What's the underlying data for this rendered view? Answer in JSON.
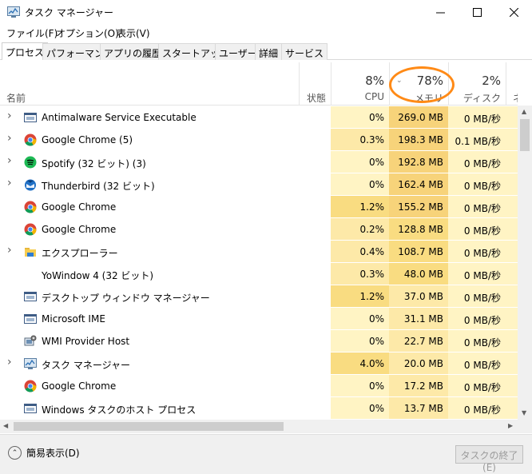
{
  "window": {
    "title": "タスク マネージャー",
    "controls": {
      "minimize": "—",
      "maximize": "☐",
      "close": "✕"
    }
  },
  "menu": [
    "ファイル(F)",
    "オプション(O)",
    "表示(V)"
  ],
  "tabs": [
    "プロセス",
    "パフォーマンス",
    "アプリの履歴",
    "スタートアップ",
    "ユーザー",
    "詳細",
    "サービス"
  ],
  "active_tab": "プロセス",
  "header": {
    "name": "名前",
    "status": "状態",
    "cpu": {
      "pct": "8%",
      "label": "CPU"
    },
    "memory": {
      "pct": "78%",
      "label": "メモリ"
    },
    "disk": {
      "pct": "2%",
      "label": "ディスク"
    },
    "network": {
      "label": "ネッ"
    }
  },
  "processes": [
    {
      "name": "Antimalware Service Executable",
      "icon": "service-window-icon",
      "expandable": true,
      "cpu": "0%",
      "memory": "269.0 MB",
      "disk": "0 MB/秒"
    },
    {
      "name": "Google Chrome (5)",
      "icon": "chrome-icon",
      "expandable": true,
      "cpu": "0.3%",
      "memory": "198.3 MB",
      "disk": "0.1 MB/秒"
    },
    {
      "name": "Spotify (32 ビット) (3)",
      "icon": "spotify-icon",
      "expandable": true,
      "cpu": "0%",
      "memory": "192.8 MB",
      "disk": "0 MB/秒"
    },
    {
      "name": "Thunderbird (32 ビット)",
      "icon": "thunderbird-icon",
      "expandable": true,
      "cpu": "0%",
      "memory": "162.4 MB",
      "disk": "0 MB/秒"
    },
    {
      "name": "Google Chrome",
      "icon": "chrome-icon",
      "expandable": false,
      "cpu": "1.2%",
      "memory": "155.2 MB",
      "disk": "0 MB/秒"
    },
    {
      "name": "Google Chrome",
      "icon": "chrome-icon",
      "expandable": false,
      "cpu": "0.2%",
      "memory": "128.8 MB",
      "disk": "0 MB/秒"
    },
    {
      "name": "エクスプローラー",
      "icon": "folder-icon",
      "expandable": true,
      "cpu": "0.4%",
      "memory": "108.7 MB",
      "disk": "0 MB/秒"
    },
    {
      "name": "YoWindow 4 (32 ビット)",
      "icon": "none",
      "expandable": false,
      "cpu": "0.3%",
      "memory": "48.0 MB",
      "disk": "0 MB/秒"
    },
    {
      "name": "デスクトップ ウィンドウ マネージャー",
      "icon": "service-window-icon",
      "expandable": false,
      "cpu": "1.2%",
      "memory": "37.0 MB",
      "disk": "0 MB/秒"
    },
    {
      "name": "Microsoft IME",
      "icon": "service-window-icon",
      "expandable": false,
      "cpu": "0%",
      "memory": "31.1 MB",
      "disk": "0 MB/秒"
    },
    {
      "name": "WMI Provider Host",
      "icon": "wmi-icon",
      "expandable": false,
      "cpu": "0%",
      "memory": "22.7 MB",
      "disk": "0 MB/秒"
    },
    {
      "name": "タスク マネージャー",
      "icon": "task-manager-icon",
      "expandable": true,
      "cpu": "4.0%",
      "memory": "20.0 MB",
      "disk": "0 MB/秒"
    },
    {
      "name": "Google Chrome",
      "icon": "chrome-icon",
      "expandable": false,
      "cpu": "0%",
      "memory": "17.2 MB",
      "disk": "0 MB/秒"
    },
    {
      "name": "Windows タスクのホスト プロセス",
      "icon": "service-window-icon",
      "expandable": false,
      "cpu": "0%",
      "memory": "13.7 MB",
      "disk": "0 MB/秒"
    }
  ],
  "footer": {
    "fewer_details": "簡易表示(D)",
    "end_task": "タスクの終了(E)"
  },
  "colors": {
    "highlight_oval": "#ff8a16",
    "heat_light": "#fff4c4",
    "heat_mid": "#fde9a8",
    "heat_strong": "#f9dc81"
  }
}
